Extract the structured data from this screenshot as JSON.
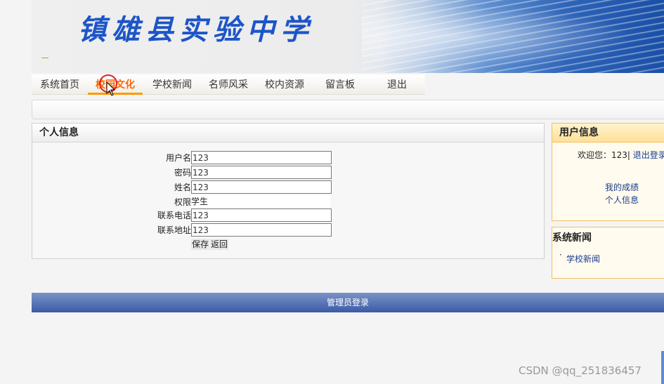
{
  "banner": {
    "site_title": "镇雄县实验中学"
  },
  "nav": {
    "items": [
      {
        "label": "系统首页"
      },
      {
        "label": "校园文化"
      },
      {
        "label": "学校新闻"
      },
      {
        "label": "名师风采"
      },
      {
        "label": "校内资源"
      },
      {
        "label": "留言板"
      },
      {
        "label": "退出"
      }
    ],
    "active_index": 1
  },
  "profile": {
    "title": "个人信息",
    "fields": {
      "username": {
        "label": "用户名",
        "value": "123"
      },
      "password": {
        "label": "密码",
        "value": "123"
      },
      "name": {
        "label": "姓名",
        "value": "123"
      },
      "role": {
        "label": "权限",
        "value": "学生"
      },
      "phone": {
        "label": "联系电话",
        "value": "123"
      },
      "address": {
        "label": "联系地址",
        "value": "123"
      }
    },
    "save_label": "保存",
    "back_label": "返回"
  },
  "user_info": {
    "title": "用户信息",
    "welcome_prefix": "欢迎您：",
    "username": "123",
    "separator": "|",
    "logout_label": "退出登录",
    "links": [
      "我的成绩",
      "个人信息"
    ]
  },
  "system_news": {
    "title": "系统新闻",
    "items": [
      "学校新闻"
    ]
  },
  "footer": {
    "admin_login_label": "管理员登录"
  },
  "watermark": "CSDN @qq_251836457",
  "colors": {
    "accent": "#ff6600",
    "link": "#1a3d8f",
    "footer_bar": "#3b5ba8"
  }
}
